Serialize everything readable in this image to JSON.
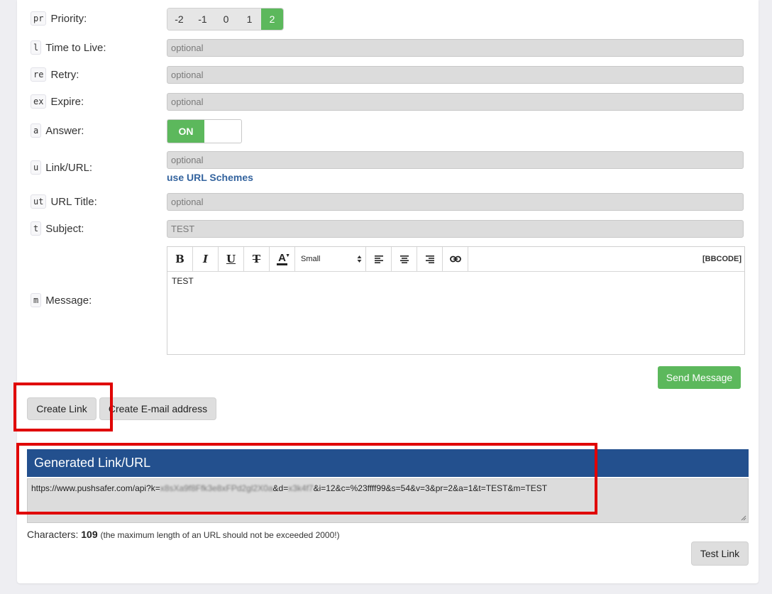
{
  "fields": {
    "priority": {
      "code": "pr",
      "label": "Priority:",
      "options": [
        "-2",
        "-1",
        "0",
        "1",
        "2"
      ],
      "selected": "2"
    },
    "ttl": {
      "code": "l",
      "label": "Time to Live:",
      "placeholder": "optional"
    },
    "retry": {
      "code": "re",
      "label": "Retry:",
      "placeholder": "optional"
    },
    "expire": {
      "code": "ex",
      "label": "Expire:",
      "placeholder": "optional"
    },
    "answer": {
      "code": "a",
      "label": "Answer:",
      "state": "ON"
    },
    "url": {
      "code": "u",
      "label": "Link/URL:",
      "placeholder": "optional",
      "help_link": "use URL Schemes"
    },
    "url_title": {
      "code": "ut",
      "label": "URL Title:",
      "placeholder": "optional"
    },
    "subject": {
      "code": "t",
      "label": "Subject:",
      "value": "TEST"
    },
    "message": {
      "code": "m",
      "label": "Message:",
      "value": "TEST"
    }
  },
  "editor": {
    "toolbar": {
      "bold": "B",
      "italic": "I",
      "underline": "U",
      "strike": "T",
      "color": "A",
      "size": "Small",
      "mode": "[BBCODE]"
    }
  },
  "buttons": {
    "send": "Send Message",
    "create_link": "Create Link",
    "create_email": "Create E-mail address",
    "test_link": "Test Link"
  },
  "generated": {
    "title": "Generated Link/URL",
    "url_prefix": "https://www.pushsafer.com/api?k=",
    "url_key_redacted": "x8sXa9f8Ffk3e8xFPd2gl2X0a",
    "url_mid": "&d=",
    "url_device_redacted": "x3k4f7",
    "url_suffix": "&i=12&c=%23ffff99&s=54&v=3&pr=2&a=1&t=TEST&m=TEST"
  },
  "characters": {
    "label": "Characters:",
    "count": "109",
    "note": "(the maximum length of an URL should not be exceeded 2000!)"
  },
  "colors": {
    "accent_green": "#5cb85c",
    "header_blue": "#23508e",
    "highlight_red": "#e00000"
  }
}
